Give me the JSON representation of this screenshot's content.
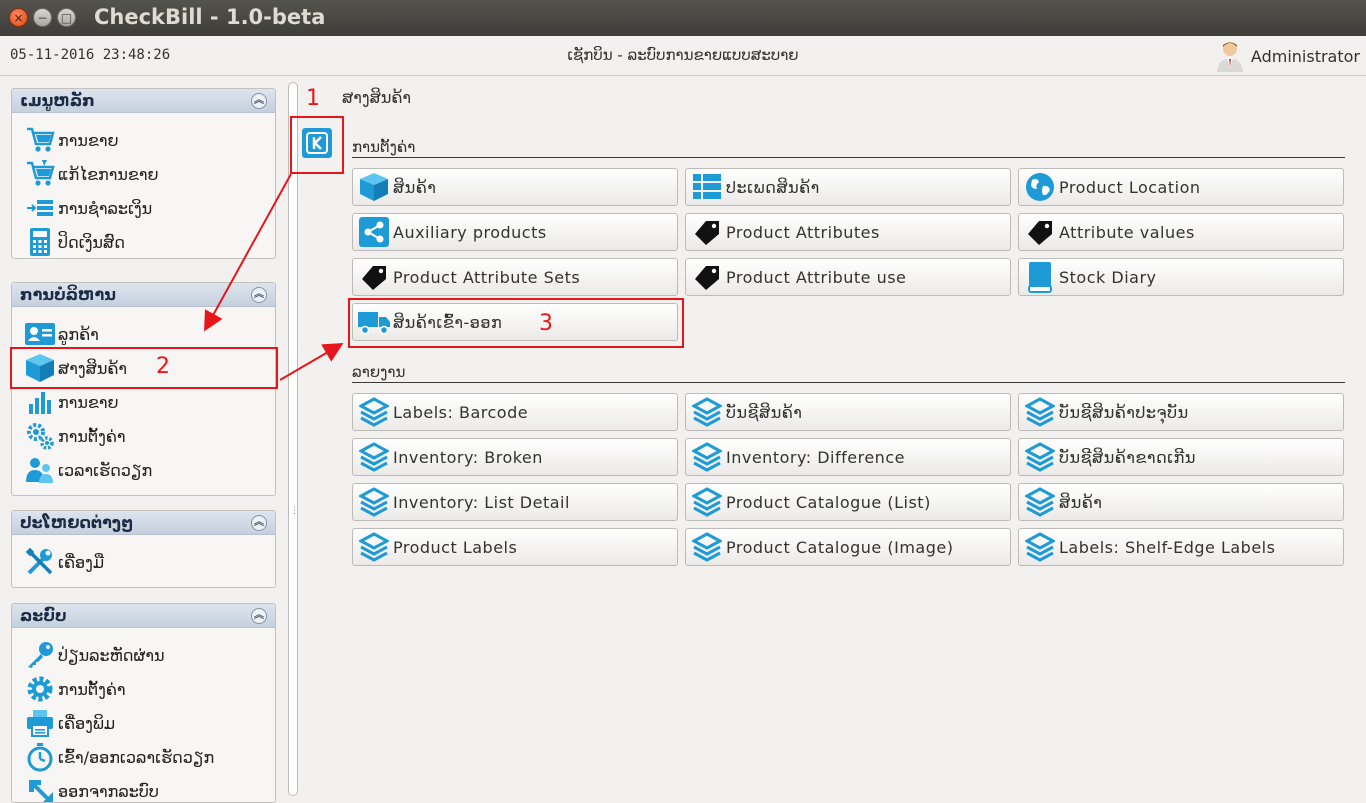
{
  "window": {
    "title": "CheckBill - 1.0-beta",
    "close_label": "×",
    "min_label": "−",
    "max_label": "□"
  },
  "status": {
    "datetime": "05-11-2016 23:48:26",
    "screen_title": "ເຊັກບິນ - ລະບົບການຂາຍແບບສະບາຍ",
    "user": "Administrator"
  },
  "sidebar": {
    "main_menu": {
      "title": "ເມນູຫລັກ",
      "items": [
        {
          "label": "ການຂາຍ",
          "icon": "cart-icon"
        },
        {
          "label": "ແກ້ໄຂການຂາຍ",
          "icon": "cart-edit-icon"
        },
        {
          "label": "ການຊຳລະເງິນ",
          "icon": "payment-icon"
        },
        {
          "label": "ປິດເງິນສົດ",
          "icon": "calculator-icon"
        }
      ]
    },
    "management": {
      "title": "ການບໍລິຫານ",
      "items": [
        {
          "label": "ລູກຄ້າ",
          "icon": "customer-card-icon"
        },
        {
          "label": "ສາງສິນຄ້າ",
          "icon": "cube-icon"
        },
        {
          "label": "ການຂາຍ",
          "icon": "bar-chart-icon"
        },
        {
          "label": "ການຕັ້ງຄ່າ",
          "icon": "gears-icon"
        },
        {
          "label": "ເວລາເຮັດວຽກ",
          "icon": "people-icon"
        }
      ]
    },
    "utilities": {
      "title": "ປະໂຫຍດຕ່າງໆ",
      "items": [
        {
          "label": "ເຄື່ອງມື",
          "icon": "tools-icon"
        }
      ]
    },
    "system": {
      "title": "ລະບົບ",
      "items": [
        {
          "label": "ປ່ຽນລະຫັດຜ່ານ",
          "icon": "key-icon"
        },
        {
          "label": "ການຕັ້ງຄ່າ",
          "icon": "gear-icon"
        },
        {
          "label": "ເຄື່ອງພິມ",
          "icon": "printer-icon"
        },
        {
          "label": "ເຂົ້າ/ອອກເວລາເຮັດວຽກ",
          "icon": "stopwatch-icon"
        },
        {
          "label": "ອອກຈາກລະບົບ",
          "icon": "logout-icon"
        }
      ]
    },
    "collapse_glyph": "︽"
  },
  "main": {
    "breadcrumb": "ສາງສິນຄ້າ",
    "settings_section": "ການຕັ້ງຄ່າ",
    "reports_section": "ລາຍງານ",
    "settings_tiles": [
      {
        "label": "ສິນຄ້າ",
        "icon": "cube-icon"
      },
      {
        "label": "ປະເພດສິນຄ້າ",
        "icon": "list-icon"
      },
      {
        "label": "Product Location",
        "icon": "globe-icon"
      },
      {
        "label": "Auxiliary products",
        "icon": "share-icon"
      },
      {
        "label": "Product Attributes",
        "icon": "tag-icon"
      },
      {
        "label": "Attribute values",
        "icon": "tag-icon"
      },
      {
        "label": "Product Attribute Sets",
        "icon": "tag-icon"
      },
      {
        "label": "Product Attribute use",
        "icon": "tag-icon"
      },
      {
        "label": "Stock Diary",
        "icon": "book-icon"
      },
      {
        "label": "ສິນຄ້າເຂົ້າ-ອອກ",
        "icon": "truck-icon"
      }
    ],
    "report_tiles": [
      {
        "label": "Labels: Barcode"
      },
      {
        "label": "ບັນຊີສິນຄ້າ"
      },
      {
        "label": "ບັນຊີສິນຄ້າປະຈຸບັນ"
      },
      {
        "label": "Inventory: Broken"
      },
      {
        "label": "Inventory: Difference"
      },
      {
        "label": "ບັນຊີສິນຄ້າຂາດເກີນ"
      },
      {
        "label": "Inventory: List Detail"
      },
      {
        "label": "Product Catalogue (List)"
      },
      {
        "label": "ສິນຄ້າ"
      },
      {
        "label": "Product Labels"
      },
      {
        "label": "Product Catalogue (Image)"
      },
      {
        "label": "Labels: Shelf-Edge Labels"
      }
    ],
    "k_button": "K"
  },
  "annotations": {
    "n1": "1",
    "n2": "2",
    "n3": "3",
    "color": "#e8161a"
  }
}
